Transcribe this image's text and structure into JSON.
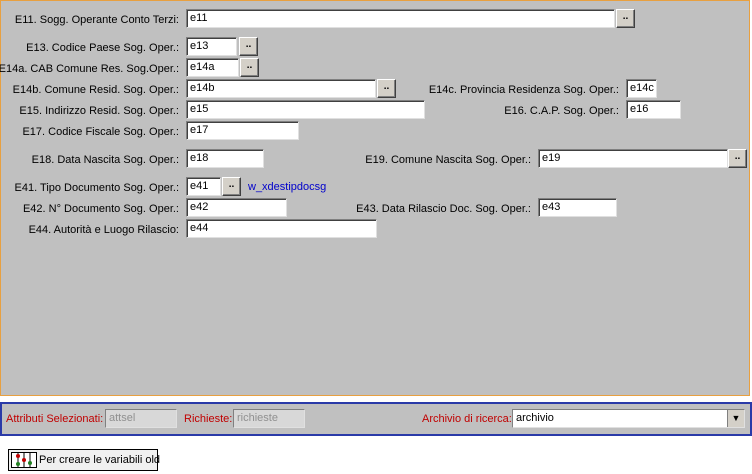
{
  "fields": {
    "e11": {
      "label": "E11. Sogg. Operante Conto Terzi:",
      "value": "e11"
    },
    "e13": {
      "label": "E13. Codice Paese Sog. Oper.:",
      "value": "e13"
    },
    "e14a": {
      "label": "E14a. CAB Comune Res. Sog.Oper.:",
      "value": "e14a"
    },
    "e14b": {
      "label": "E14b. Comune Resid. Sog. Oper.:",
      "value": "e14b"
    },
    "e14c": {
      "label": "E14c. Provincia Residenza Sog. Oper.:",
      "value": "e14c"
    },
    "e15": {
      "label": "E15. Indirizzo Resid. Sog. Oper.:",
      "value": "e15"
    },
    "e16": {
      "label": "E16. C.A.P. Sog. Oper.:",
      "value": "e16"
    },
    "e17": {
      "label": "E17. Codice Fiscale Sog. Oper.:",
      "value": "e17"
    },
    "e18": {
      "label": "E18. Data Nascita Sog. Oper.:",
      "value": "e18"
    },
    "e19": {
      "label": "E19. Comune Nascita Sog. Oper.:",
      "value": "e19"
    },
    "e41": {
      "label": "E41. Tipo Documento Sog. Oper.:",
      "value": "e41",
      "link": "w_xdestipdocsg"
    },
    "e42": {
      "label": "E42. N° Documento Sog. Oper.:",
      "value": "e42"
    },
    "e43": {
      "label": "E43. Data Rilascio Doc. Sog. Oper.:",
      "value": "e43"
    },
    "e44": {
      "label": "E44. Autorità e Luogo Rilascio:",
      "value": "e44"
    }
  },
  "lookup_label": "..",
  "bottom": {
    "attributi_label": "Attributi Selezionati:",
    "attributi_value": "attsel",
    "richieste_label": "Richieste:",
    "richieste_value": "richieste",
    "archivio_label": "Archivio di ricerca:",
    "archivio_value": "archivio"
  },
  "old_button_label": "Per creare le variabili old",
  "icons": {
    "lookup": "ellipsis-icon",
    "dropdown": "chevron-down-icon",
    "old_button": "abacus-icon"
  },
  "colors": {
    "panel": "#c0c0c0",
    "border_top": "#e8a040",
    "border_bottom": "#2a3aa8",
    "red_label": "#c00000",
    "link": "#0000cc"
  }
}
